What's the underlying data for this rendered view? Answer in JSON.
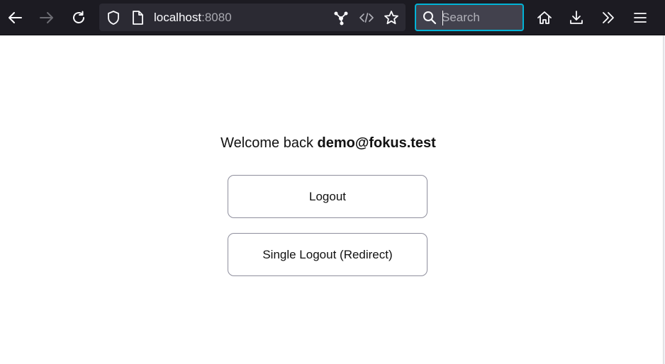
{
  "browser": {
    "url_host": "localhost",
    "url_port": ":8080",
    "search_placeholder": "Search",
    "icons": {
      "back": "arrow-left-icon",
      "forward": "arrow-right-icon",
      "reload": "reload-icon",
      "tracking_protection": "shield-icon",
      "page_info": "page-icon",
      "extension": "share-nodes-icon",
      "developer": "code-icon",
      "bookmark": "star-icon",
      "search": "magnifier-icon",
      "home": "home-icon",
      "downloads": "download-icon",
      "overflow": "chevron-double-right-icon",
      "menu": "hamburger-icon"
    },
    "colors": {
      "toolbar_bg": "#1c1b22",
      "urlbar_bg": "#2b2a33",
      "search_focus": "#00b3d6"
    }
  },
  "page": {
    "welcome_prefix": "Welcome back",
    "user_email": "demo@fokus.test",
    "buttons": {
      "logout": "Logout",
      "single_logout": "Single Logout (Redirect)"
    }
  }
}
